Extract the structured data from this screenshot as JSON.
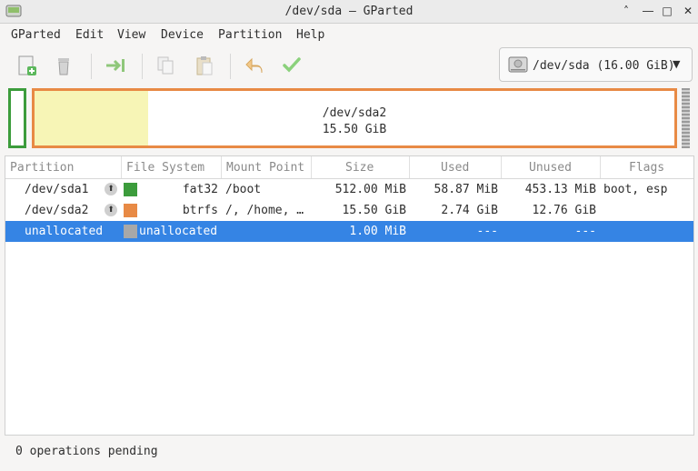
{
  "window": {
    "title": "/dev/sda – GParted"
  },
  "menu": [
    "GParted",
    "Edit",
    "View",
    "Device",
    "Partition",
    "Help"
  ],
  "toolbar": {
    "buttons": [
      "new-partition",
      "delete",
      "resize-move",
      "copy",
      "paste",
      "undo",
      "apply"
    ]
  },
  "device": {
    "label": "/dev/sda (16.00 GiB)"
  },
  "diskmap": {
    "selected_name": "/dev/sda2",
    "selected_size": "15.50 GiB"
  },
  "table": {
    "headers": [
      "Partition",
      "File System",
      "Mount Point",
      "Size",
      "Used",
      "Unused",
      "Flags"
    ],
    "rows": [
      {
        "partition": "/dev/sda1",
        "fs": "fat32",
        "mount": "/boot",
        "size": "512.00 MiB",
        "used": "58.87 MiB",
        "unused": "453.13 MiB",
        "flags": "boot, esp",
        "color": "#3c9c3c"
      },
      {
        "partition": "/dev/sda2",
        "fs": "btrfs",
        "mount": "/, /home, …",
        "size": "15.50 GiB",
        "used": "2.74 GiB",
        "unused": "12.76 GiB",
        "flags": "",
        "color": "#e88a45"
      },
      {
        "partition": "unallocated",
        "fs": "unallocated",
        "mount": "",
        "size": "1.00 MiB",
        "used": "---",
        "unused": "---",
        "flags": "",
        "color": "#a8a8a8"
      }
    ]
  },
  "status": "0 operations pending",
  "colors": {
    "selection": "#3584e4",
    "fat32": "#3c9c3c",
    "btrfs": "#e88a45",
    "unallocated": "#a8a8a8"
  }
}
